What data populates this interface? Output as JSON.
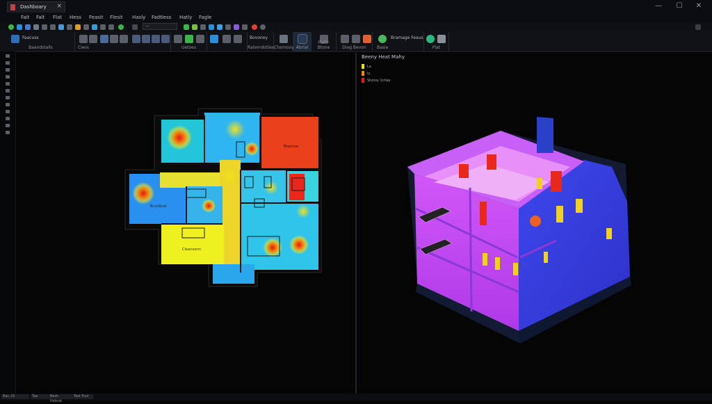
{
  "window": {
    "tab_title": "Dashboary",
    "tab_close": "×",
    "controls": {
      "minimize": "—",
      "maximize": "☐",
      "close": "✕"
    }
  },
  "menu": {
    "items": [
      "Fait",
      "Falt",
      "Flat",
      "Hess",
      "Feasit",
      "Flesit",
      "Hasly",
      "Fadtless",
      "Hatly",
      "Fagle"
    ]
  },
  "quick_access": {
    "field_value": "—"
  },
  "ribbon": {
    "groups": [
      {
        "label": "Baandstalls",
        "top_text": "Faacuss"
      },
      {
        "label": "Cwos"
      },
      {
        "label": "Uetoes"
      },
      {
        "label": "Ratemdoties",
        "top_text": "Bovonoy"
      },
      {
        "label": "Chsmosiy"
      },
      {
        "label": "Abrial"
      },
      {
        "label": "Flattr Btone"
      },
      {
        "label": "Diag Bevon"
      },
      {
        "label": "Basie",
        "top_text": "Bramage Feaus"
      },
      {
        "label": "Plat"
      }
    ]
  },
  "floorplan": {
    "labels": {
      "room_a": "Bnsldbsst",
      "room_b": "Etastroo",
      "room_c": "Cleanoorm"
    }
  },
  "legend": {
    "title": "Beeny Heat Mahy",
    "entries": [
      {
        "label": "La",
        "color": "#f2e600"
      },
      {
        "label": "Iy",
        "color": "#f08a00"
      },
      {
        "label": "Stonsy 1chay",
        "color": "#e02010"
      }
    ]
  },
  "statusbar": {
    "items": [
      "Bac 23",
      "Taa",
      "Besh Hebrat",
      "Tast Fusl"
    ]
  },
  "colors": {
    "heat_blue": "#2fa6f0",
    "heat_yellow": "#f0e830",
    "heat_red": "#e0281a",
    "building_magenta": "#c040f0",
    "building_blue": "#3a40e0"
  }
}
